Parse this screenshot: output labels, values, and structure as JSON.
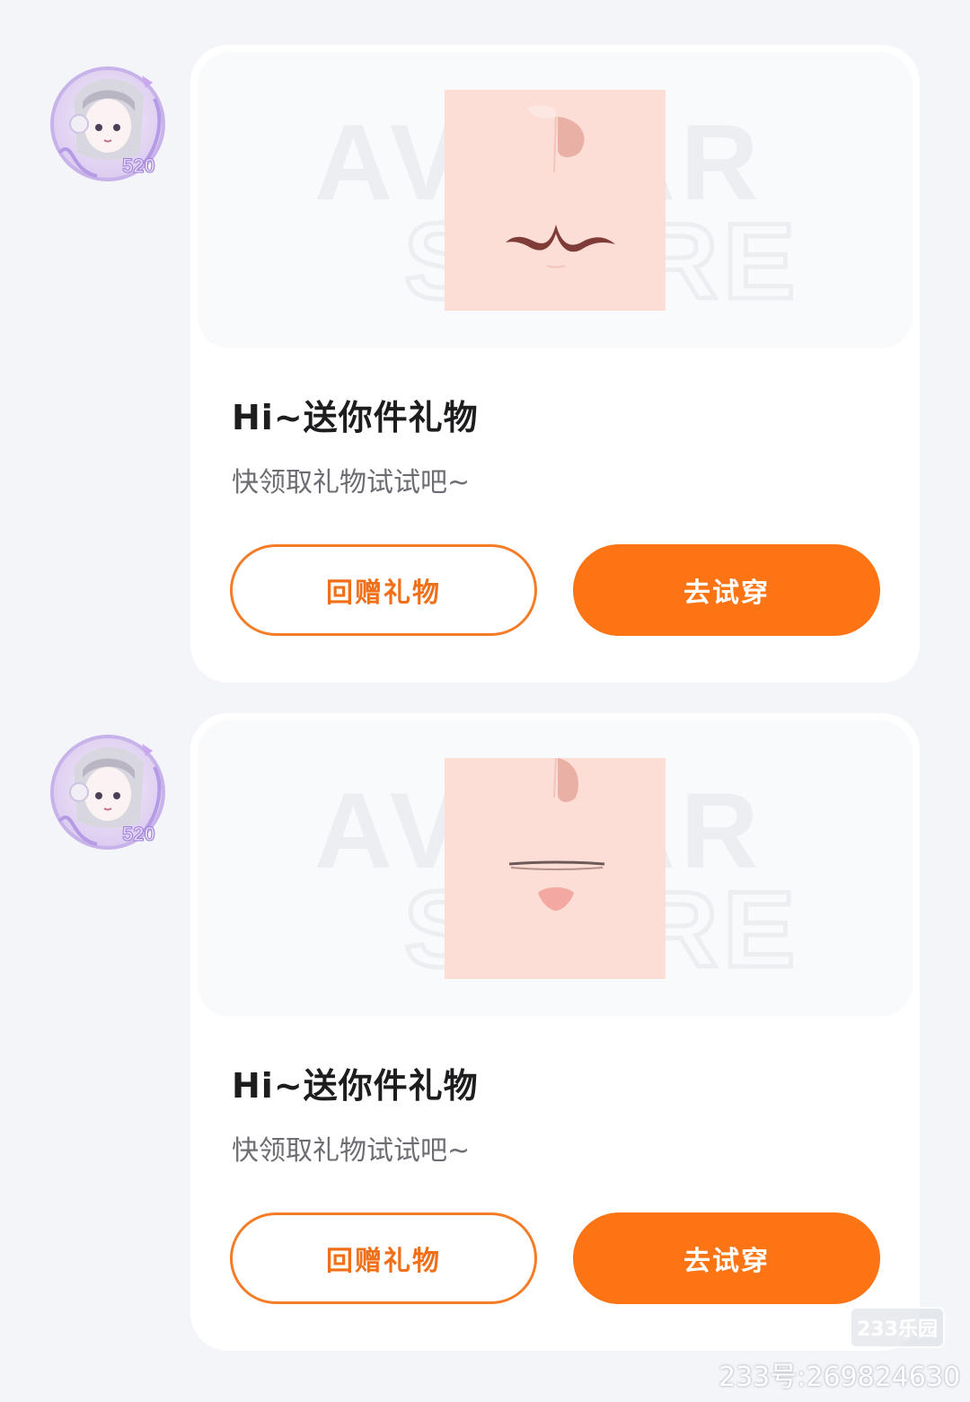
{
  "colors": {
    "background": "#f3f5f9",
    "card": "#ffffff",
    "accent_orange": "#fd7414",
    "outline_orange": "#f57c26",
    "title_text": "#1d1d1f",
    "subtitle_text": "#6b6d72"
  },
  "messages": [
    {
      "avatar_icon": "anime-girl-avatar-icon",
      "avatar_badge": "520",
      "watermark_line1": "AVATAR",
      "watermark_line2": "STORE",
      "item_icon": "face-mouth-cat-smile-icon",
      "title": "Hi~送你件礼物",
      "subtitle": "快领取礼物试试吧~",
      "return_gift_label": "回赠礼物",
      "try_on_label": "去试穿"
    },
    {
      "avatar_icon": "anime-girl-avatar-icon",
      "avatar_badge": "520",
      "watermark_line1": "AVATAR",
      "watermark_line2": "STORE",
      "item_icon": "face-mouth-tongue-icon",
      "title": "Hi~送你件礼物",
      "subtitle": "快领取礼物试试吧~",
      "return_gift_label": "回赠礼物",
      "try_on_label": "去试穿"
    }
  ],
  "corner_watermark": {
    "logo": "233乐园",
    "id_text": "233号:269824630"
  }
}
